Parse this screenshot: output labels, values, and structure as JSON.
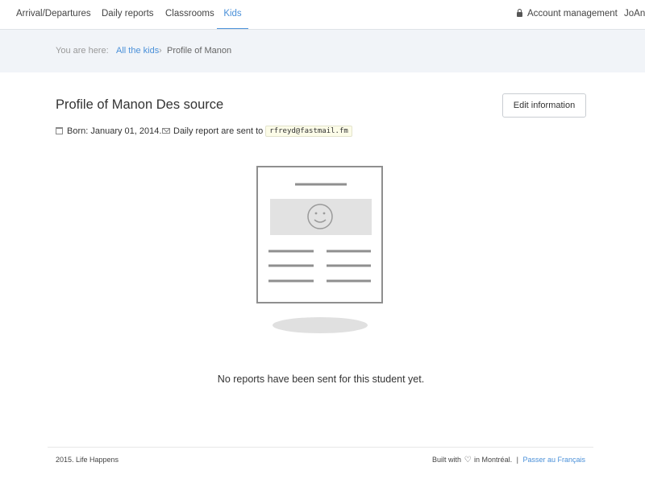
{
  "nav": {
    "items": [
      {
        "label": "Arrival/Departures"
      },
      {
        "label": "Daily reports"
      },
      {
        "label": "Classrooms"
      },
      {
        "label": "Kids"
      }
    ],
    "active": "Kids",
    "account_label": "Account management",
    "account_icon": "lock-icon",
    "user_label": "JoAnn"
  },
  "breadcrumb": {
    "prefix": "You are here:",
    "link": "All the kids",
    "separator": "›",
    "current": "Profile of Manon"
  },
  "profile": {
    "title": "Profile of Manon Des source",
    "edit_label": "Edit information",
    "born_icon": "calendar-icon",
    "born_text": "Born: January 01, 2014.",
    "report_icon": "envelope-icon",
    "report_text": "Daily report are sent to",
    "email": "rfreyd@fastmail.fm"
  },
  "empty_state": {
    "illustration_icon": "empty-report-icon",
    "message": "No reports have been sent for this student yet."
  },
  "footer": {
    "copyright": "2015. Life Happens",
    "built_prefix": "Built with",
    "heart_icon": "heart-icon",
    "built_suffix": "in Montréal.",
    "separator": "|",
    "language_link": "Passer au Français"
  },
  "colors": {
    "accent": "#4a90d9",
    "breadcrumb_band": "#f1f4f8",
    "email_highlight": "#fcfce8"
  }
}
